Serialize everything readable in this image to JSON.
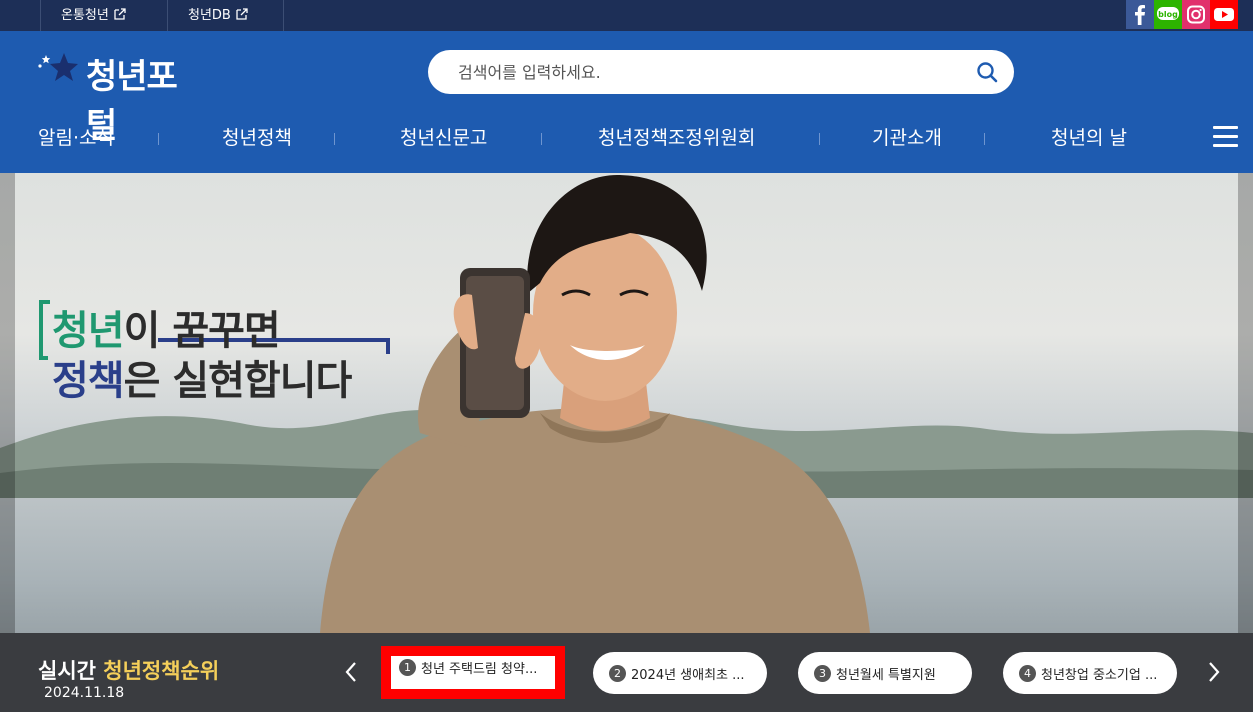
{
  "topbar": {
    "links": [
      {
        "label": "온통청년"
      },
      {
        "label": "청년DB"
      }
    ],
    "social": [
      "facebook-icon",
      "blog-icon",
      "instagram-icon",
      "youtube-icon"
    ],
    "social_colors": {
      "facebook": "#3b5998",
      "blog": "#2db400",
      "instagram": "#e1306c",
      "youtube": "#ff0000"
    }
  },
  "header": {
    "logo_text": "청년포털",
    "search_placeholder": "검색어를 입력하세요.",
    "nav": [
      {
        "label": "알림·소식"
      },
      {
        "label": "청년정책"
      },
      {
        "label": "청년신문고"
      },
      {
        "label": "청년정책조정위원회"
      },
      {
        "label": "기관소개"
      },
      {
        "label": "청년의 날"
      }
    ],
    "brand_color": "#1e5bb0"
  },
  "hero": {
    "line1_a": "청년",
    "line1_b": "이 꿈꾸면",
    "line2_a": "정책",
    "line2_b": "은 실현합니다"
  },
  "ranking": {
    "title_a": "실시간 ",
    "title_b": "청년정책순위",
    "date": "2024.11.18",
    "items": [
      {
        "num": "1",
        "label": "청년 주택드림 청약..."
      },
      {
        "num": "2",
        "label": "2024년 생애최초 ..."
      },
      {
        "num": "3",
        "label": "청년월세 특별지원"
      },
      {
        "num": "4",
        "label": "청년창업 중소기업 ..."
      }
    ],
    "highlight_color": "#f4cf5a"
  }
}
